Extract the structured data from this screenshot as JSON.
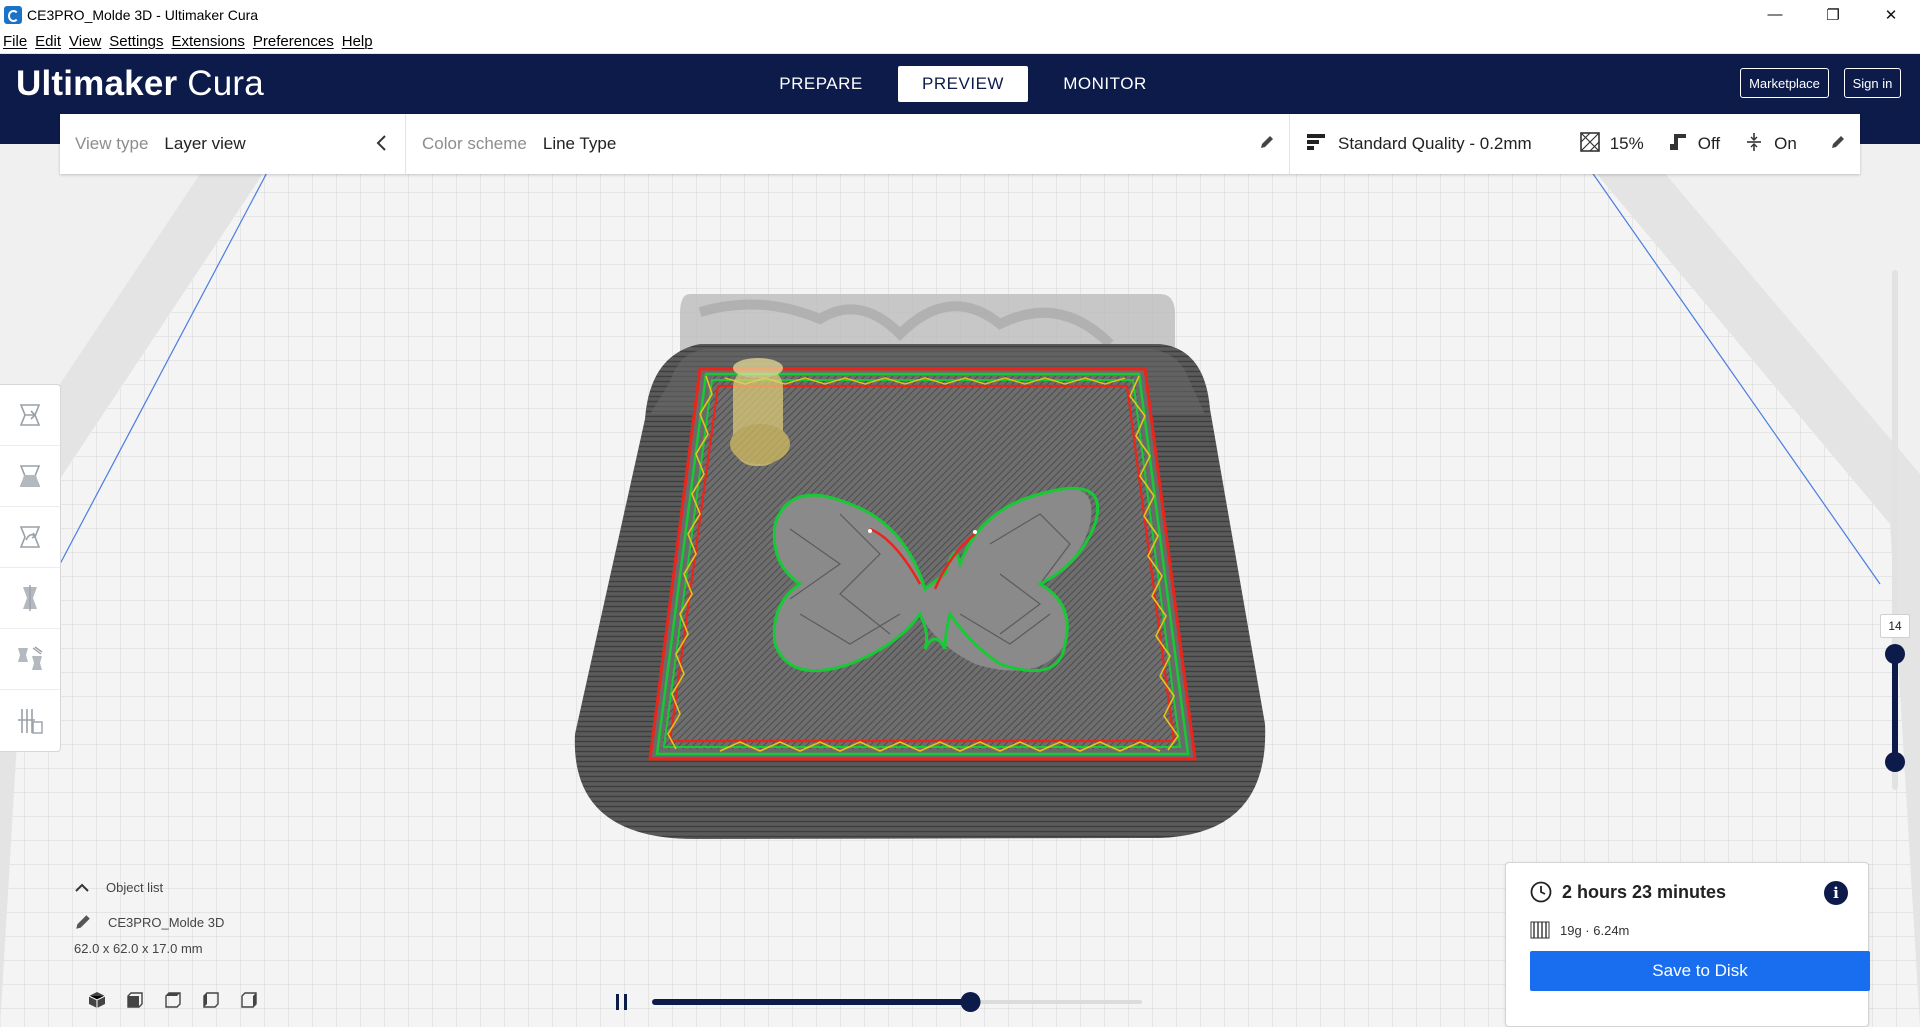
{
  "window": {
    "title": "CE3PRO_Molde 3D - Ultimaker Cura",
    "minimize": "—",
    "restore": "❐",
    "close": "✕"
  },
  "menu": [
    "File",
    "Edit",
    "View",
    "Settings",
    "Extensions",
    "Preferences",
    "Help"
  ],
  "header": {
    "brand": "Ultimaker",
    "product": "Cura",
    "stages": [
      {
        "label": "PREPARE",
        "active": false
      },
      {
        "label": "PREVIEW",
        "active": true
      },
      {
        "label": "MONITOR",
        "active": false
      }
    ],
    "marketplace": "Marketplace",
    "signin": "Sign in"
  },
  "topbar": {
    "view_type_label": "View type",
    "view_type_value": "Layer view",
    "color_scheme_label": "Color scheme",
    "color_scheme_value": "Line Type",
    "quality": "Standard Quality - 0.2mm",
    "infill": "15%",
    "support": "Off",
    "adhesion": "On"
  },
  "tools": [
    "move-tool",
    "scale-tool",
    "rotate-tool",
    "mirror-tool",
    "per-model-settings-tool",
    "support-blocker-tool"
  ],
  "layer_slider": {
    "current_layer": "14",
    "upper_fraction": 0.26,
    "lower_fraction": 0.0
  },
  "object_list": {
    "toggle_label": "Object list",
    "object_name": "CE3PRO_Molde 3D",
    "dimensions": "62.0 x 62.0 x 17.0 mm"
  },
  "simulation": {
    "progress_fraction": 0.65
  },
  "output": {
    "print_time": "2 hours 23 minutes",
    "material": "19g · 6.24m",
    "save_label": "Save to Disk"
  },
  "colors": {
    "header_bg": "#0d1b4b",
    "accent_blue": "#196ef0",
    "wall_outer": "#e8261c",
    "wall_inner": "#18c936",
    "skin": "#e6c317",
    "plate": "#f0f0f0"
  }
}
